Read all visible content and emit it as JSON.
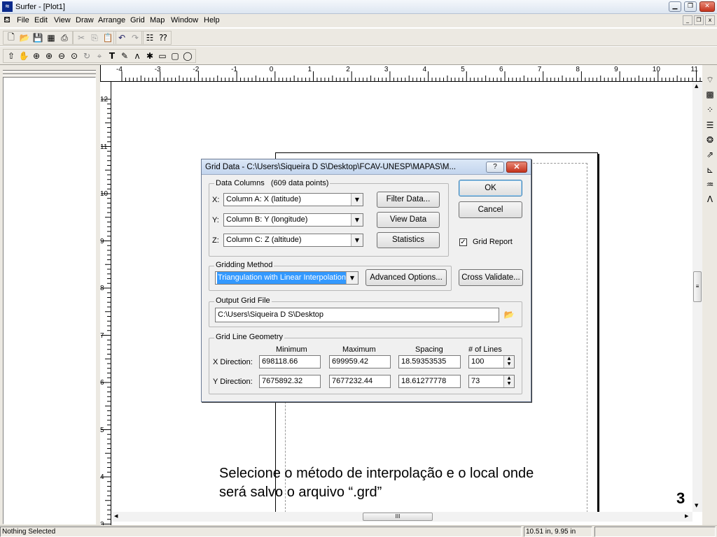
{
  "window": {
    "title": "Surfer - [Plot1]"
  },
  "menubar": {
    "items": [
      "File",
      "Edit",
      "View",
      "Draw",
      "Arrange",
      "Grid",
      "Map",
      "Window",
      "Help"
    ]
  },
  "ruler": {
    "top_labels": [
      "-4",
      "-3",
      "-2",
      "-1",
      "0",
      "1",
      "2",
      "3",
      "4",
      "5",
      "6",
      "7",
      "8",
      "9",
      "10",
      "11"
    ],
    "left_labels": [
      "12",
      "11",
      "10",
      "9",
      "8",
      "7",
      "6",
      "5",
      "4",
      "3"
    ]
  },
  "status": {
    "left": "Nothing Selected",
    "coords": "10.51 in, 9.95 in"
  },
  "dialog": {
    "title": "Grid Data - C:\\Users\\Siqueira D S\\Desktop\\FCAV-UNESP\\MAPAS\\M...",
    "data_columns": {
      "label": "Data Columns",
      "count": "(609 data points)",
      "x_label": "X:",
      "x_value": "Column A:  X (latitude)",
      "y_label": "Y:",
      "y_value": "Column B:  Y (longitude)",
      "z_label": "Z:",
      "z_value": "Column C:  Z (altitude)"
    },
    "buttons": {
      "filter": "Filter Data...",
      "view": "View Data",
      "statistics": "Statistics",
      "ok": "OK",
      "cancel": "Cancel",
      "advanced": "Advanced Options...",
      "cross_validate": "Cross Validate..."
    },
    "grid_report": {
      "label": "Grid Report",
      "checked": true
    },
    "gridding": {
      "label": "Gridding Method",
      "value": "Triangulation with Linear Interpolation"
    },
    "output": {
      "label": "Output Grid File",
      "value": "C:\\Users\\Siqueira D S\\Desktop"
    },
    "geometry": {
      "label": "Grid Line Geometry",
      "headers": [
        "Minimum",
        "Maximum",
        "Spacing",
        "# of Lines"
      ],
      "x": {
        "label": "X Direction:",
        "min": "698118.66",
        "max": "699959.42",
        "spacing": "18.59353535",
        "lines": "100"
      },
      "y": {
        "label": "Y Direction:",
        "min": "7675892.32",
        "max": "7677232.44",
        "spacing": "18.61277778",
        "lines": "73"
      }
    }
  },
  "caption": {
    "line1": "Selecione o método de interpolação e o local onde",
    "line2": "será salvo o arquivo “.grd”"
  },
  "slide_number": "3"
}
